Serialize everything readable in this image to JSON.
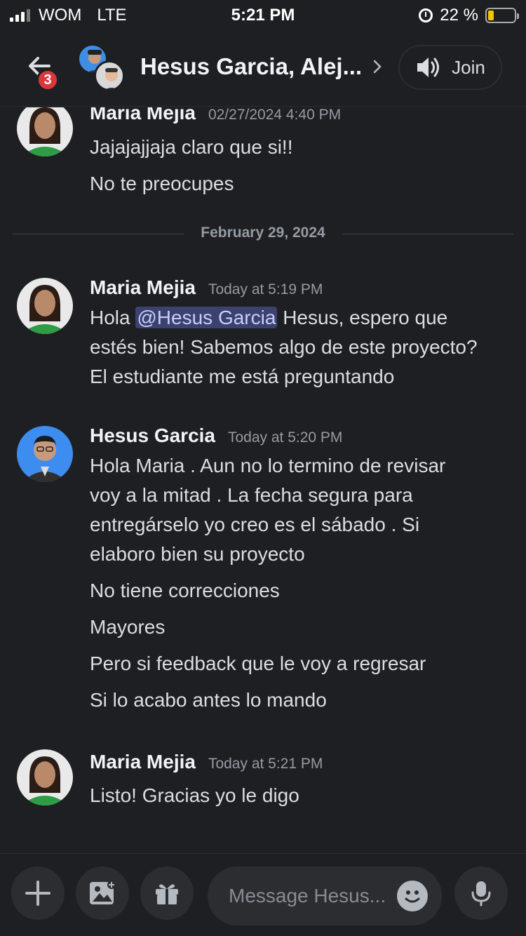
{
  "status_bar": {
    "carrier": "WOM",
    "network": "LTE",
    "time": "5:21 PM",
    "battery_text": "22 %",
    "battery_level": 0.22
  },
  "header": {
    "back_badge": "3",
    "title": "Hesus Garcia, Alej...",
    "join_label": "Join"
  },
  "messages": [
    {
      "author": "Maria Mejia",
      "timestamp": "02/27/2024 4:40 PM",
      "lines": [
        "Jajajajjaja claro que si!!",
        "No te preocupes"
      ]
    },
    {
      "divider": "February 29, 2024"
    },
    {
      "author": "Maria Mejia",
      "timestamp": "Today at 5:19 PM",
      "mention_prefix": "Hola ",
      "mention": "@Hesus Garcia",
      "mention_suffix": " Hesus, espero que",
      "lines": [
        "estés bien! Sabemos algo de este proyecto?",
        "El estudiante me está preguntando"
      ]
    },
    {
      "author": "Hesus Garcia",
      "timestamp": "Today at 5:20 PM",
      "lines": [
        "Hola Maria . Aun no lo termino de revisar",
        "voy a la mitad . La fecha segura para",
        "entregárselo yo creo es el sábado .  Si",
        "elaboro bien su proyecto",
        "No tiene correcciones",
        "Mayores",
        "Pero si feedback que le voy a regresar",
        "Si lo acabo antes lo mando"
      ]
    },
    {
      "author": "Maria Mejia",
      "timestamp": "Today at 5:21 PM",
      "lines": [
        "Listo! Gracias yo le digo"
      ]
    }
  ],
  "composer": {
    "placeholder": "Message Hesus..."
  },
  "colors": {
    "background": "#1e1f22",
    "mention_bg": "#3c4270",
    "badge": "#da373c"
  }
}
